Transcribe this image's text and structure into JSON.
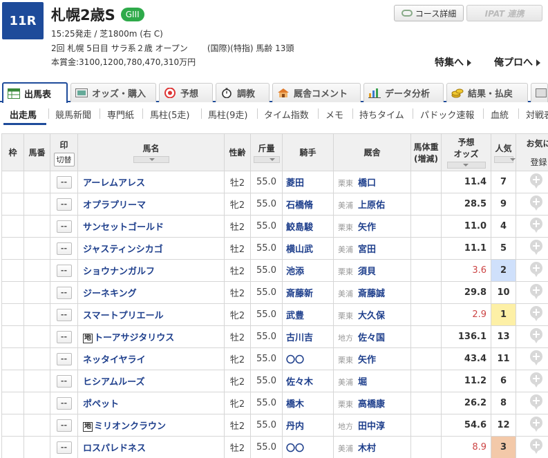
{
  "race": {
    "number": "11R",
    "name": "札幌2歳S",
    "grade": "GIII",
    "line1": "15:25発走 / 芝1800m (右 C)",
    "line2a": "2回 札幌 5日目 サラ系２歳 オープン",
    "line2b": "(国際)(特指) 馬齢 13頭",
    "line3": "本賞金:3100,1200,780,470,310万円"
  },
  "header_buttons": {
    "course": "コース詳細",
    "ipat": "IPAT 連携",
    "feature": "特集へ",
    "pro": "俺プロへ"
  },
  "main_tabs": [
    {
      "label": "出馬表",
      "icon": "table-icon"
    },
    {
      "label": "オッズ・購入",
      "icon": "odds-icon"
    },
    {
      "label": "予想",
      "icon": "target-icon"
    },
    {
      "label": "調教",
      "icon": "stopwatch-icon"
    },
    {
      "label": "厩舎コメント",
      "icon": "stable-icon"
    },
    {
      "label": "データ分析",
      "icon": "bar-chart-icon"
    },
    {
      "label": "結果・払戻",
      "icon": "coins-icon"
    }
  ],
  "sub_tabs": [
    "出走馬",
    "競馬新聞",
    "専門紙",
    "馬柱(5走)",
    "馬柱(9走)",
    "タイム指数",
    "メモ",
    "持ちタイム",
    "パドック速報",
    "血統",
    "対戦表"
  ],
  "table_headers": {
    "waku": "枠",
    "umaban": "馬番",
    "mark": "印",
    "kirikae": "切替",
    "horse": "馬名",
    "sexage": "性齢",
    "weight": "斤量",
    "jockey": "騎手",
    "stable": "厩舎",
    "body_weight": "馬体重",
    "body_diff": "(増減)",
    "odds_a": "予想",
    "odds_b": "オッズ",
    "popularity": "人気",
    "fav": "お気に",
    "fav_reg": "登録"
  },
  "mark_placeholder": "--",
  "horses": [
    {
      "chiho": "",
      "name": "アーレムアレス",
      "sexage": "牡2",
      "weight": "55.0",
      "jockey": "菱田",
      "region": "栗東",
      "trainer": "橋口",
      "odds": "11.4",
      "pop": "7",
      "hot": false
    },
    {
      "chiho": "",
      "name": "オプラプリーマ",
      "sexage": "牝2",
      "weight": "55.0",
      "jockey": "石橋脩",
      "region": "美浦",
      "trainer": "上原佑",
      "odds": "28.5",
      "pop": "9",
      "hot": false
    },
    {
      "chiho": "",
      "name": "サンセットゴールド",
      "sexage": "牡2",
      "weight": "55.0",
      "jockey": "鮫島駿",
      "region": "栗東",
      "trainer": "矢作",
      "odds": "11.0",
      "pop": "4",
      "hot": false
    },
    {
      "chiho": "",
      "name": "ジャスティンシカゴ",
      "sexage": "牡2",
      "weight": "55.0",
      "jockey": "横山武",
      "region": "美浦",
      "trainer": "宮田",
      "odds": "11.1",
      "pop": "5",
      "hot": false
    },
    {
      "chiho": "",
      "name": "ショウナンガルフ",
      "sexage": "牡2",
      "weight": "55.0",
      "jockey": "池添",
      "region": "栗東",
      "trainer": "須貝",
      "odds": "3.6",
      "pop": "2",
      "hot": true
    },
    {
      "chiho": "",
      "name": "ジーネキング",
      "sexage": "牡2",
      "weight": "55.0",
      "jockey": "斎藤新",
      "region": "美浦",
      "trainer": "斎藤誠",
      "odds": "29.8",
      "pop": "10",
      "hot": false
    },
    {
      "chiho": "",
      "name": "スマートプリエール",
      "sexage": "牝2",
      "weight": "55.0",
      "jockey": "武豊",
      "region": "栗東",
      "trainer": "大久保",
      "odds": "2.9",
      "pop": "1",
      "hot": true
    },
    {
      "chiho": "地",
      "name": "トーアサジタリウス",
      "sexage": "牡2",
      "weight": "55.0",
      "jockey": "古川吉",
      "region": "地方",
      "trainer": "佐々国",
      "odds": "136.1",
      "pop": "13",
      "hot": false
    },
    {
      "chiho": "",
      "name": "ネッタイヤライ",
      "sexage": "牝2",
      "weight": "55.0",
      "jockey": "〇〇",
      "region": "栗東",
      "trainer": "矢作",
      "odds": "43.4",
      "pop": "11",
      "hot": false
    },
    {
      "chiho": "",
      "name": "ヒシアムルーズ",
      "sexage": "牝2",
      "weight": "55.0",
      "jockey": "佐々木",
      "region": "美浦",
      "trainer": "堀",
      "odds": "11.2",
      "pop": "6",
      "hot": false
    },
    {
      "chiho": "",
      "name": "ポペット",
      "sexage": "牝2",
      "weight": "55.0",
      "jockey": "橋木",
      "region": "栗東",
      "trainer": "高橋康",
      "odds": "26.2",
      "pop": "8",
      "hot": false
    },
    {
      "chiho": "地",
      "name": "ミリオンクラウン",
      "sexage": "牡2",
      "weight": "55.0",
      "jockey": "丹内",
      "region": "地方",
      "trainer": "田中淳",
      "odds": "54.6",
      "pop": "12",
      "hot": false
    },
    {
      "chiho": "",
      "name": "ロスパレドネス",
      "sexage": "牡2",
      "weight": "55.0",
      "jockey": "〇〇",
      "region": "美浦",
      "trainer": "木村",
      "odds": "8.9",
      "pop": "3",
      "hot": true
    }
  ]
}
